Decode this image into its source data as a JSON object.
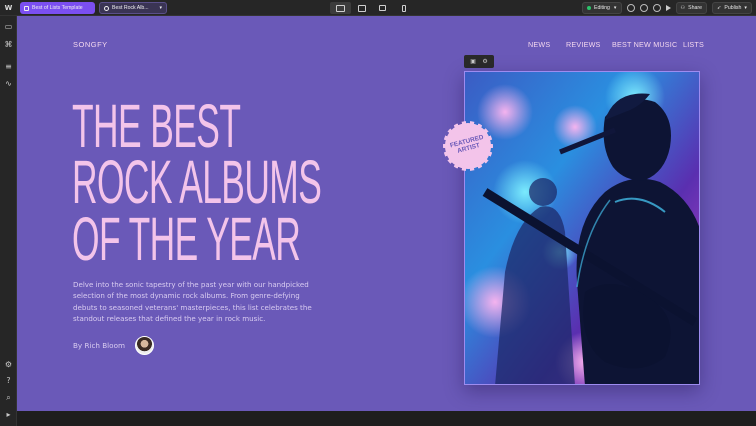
{
  "topbar": {
    "logo": "W",
    "page_chip": "Best of Lists Template",
    "cms_chip": "Best Rock Alb...",
    "editing": "Editing",
    "share": "Share",
    "publish": "Publish"
  },
  "site": {
    "brand": "SONGFY",
    "nav": [
      "NEWS",
      "REVIEWS",
      "BEST NEW MUSIC",
      "LISTS"
    ]
  },
  "hero": {
    "title_lines": [
      "THE BEST",
      "ROCK ALBUMS",
      "OF THE YEAR"
    ],
    "description": "Delve into the sonic tapestry of the past year with our handpicked selection of the most dynamic rock albums. From genre-defying debuts to seasoned veterans' masterpieces, this list celebrates the standout releases that defined the year in rock music.",
    "byline": "By Rich Bloom",
    "badge": [
      "FEATURED",
      "ARTIST"
    ]
  },
  "icons": {
    "webflow_logo": "webflow-logo-icon",
    "device_desktop": "desktop-icon",
    "device_tablet": "tablet-icon",
    "device_mobile": "mobile-icon"
  },
  "colors": {
    "canvas_bg": "#6a59b8",
    "accent_pink": "#f3c4ea",
    "chip_purple": "#7b4ff0"
  }
}
